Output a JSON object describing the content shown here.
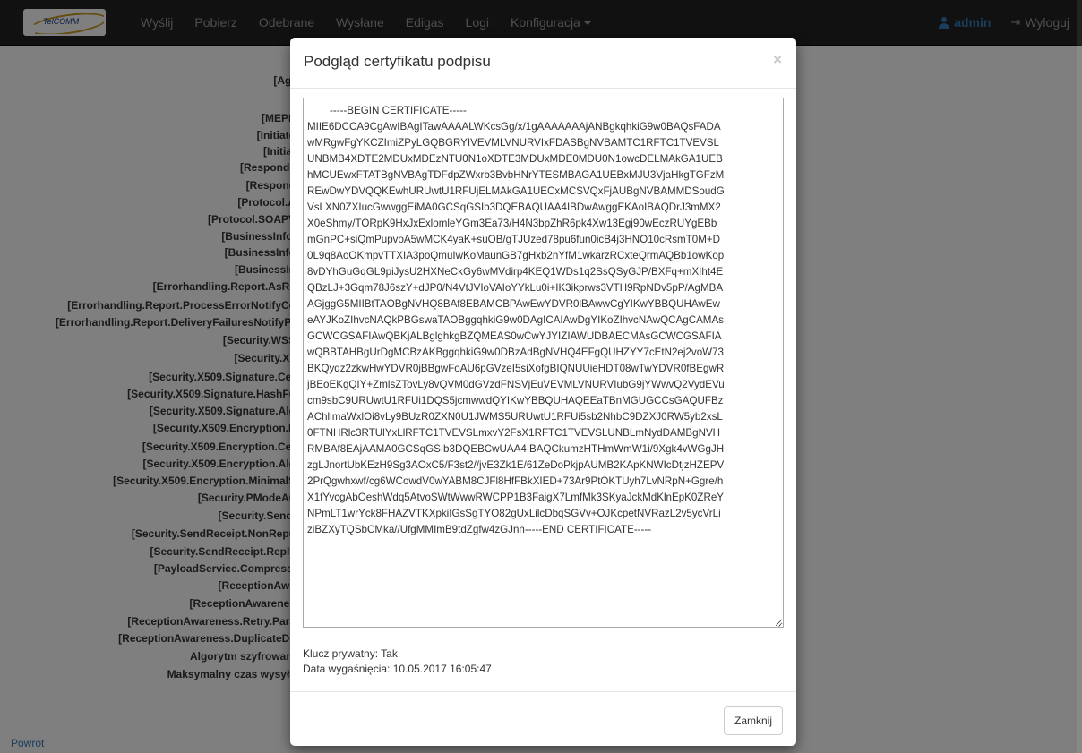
{
  "navbar": {
    "logo_text": "TelCOMM",
    "links": [
      "Wyślij",
      "Pobierz",
      "Odebrane",
      "Wysłane",
      "Edigas",
      "Logi"
    ],
    "config_label": "Konfiguracja",
    "user_label": "admin",
    "logout_label": "Wyloguj"
  },
  "background": {
    "labels": [
      "[Agr",
      "[MEPE",
      "[Initiato",
      "[Initiat",
      "[Responde",
      "[Respond",
      "[Protocol.A",
      "[Protocol.SOAPV",
      "[BusinessInfo.",
      "[BusinessInfo",
      "[BusinessIn",
      "[Errorhandling.Report.AsRe",
      "[Errorhandling.Report.ProcessErrorNotifyCo",
      "[Errorhandling.Report.DeliveryFailuresNotifyPr",
      "[Security.WSS",
      "[Security.X5",
      "[Security.X509.Signature.Cer",
      "[Security.X509.Signature.HashFu",
      "[Security.X509.Signature.Alg",
      "[Security.X509.Encryption.E",
      "[Security.X509.Encryption.Cer",
      "[Security.X509.Encryption.Alg",
      "[Security.X509.Encryption.MinimalS",
      "[Security.PModeAu",
      "[Security.Sendi",
      "[Security.SendReceipt.NonRepu",
      "[Security.SendReceipt.Reply",
      "[PayloadService.Compressi",
      "[ReceptionAwa",
      "[ReceptionAwarenes",
      "[ReceptionAwareness.Retry.Para",
      "[ReceptionAwareness.DuplicateDe",
      "Algorytm szyfrowani",
      "Maksymalny czas wysyła"
    ],
    "back_link": "Powrót"
  },
  "modal": {
    "title": "Podgląd certyfikatu podpisu",
    "close_symbol": "×",
    "certificate_lines": [
      "-----BEGIN CERTIFICATE-----",
      "MIIE6DCCA9CgAwIBAgITawAAAALWKcsGg/x/1gAAAAAAAjANBgkqhkiG9w0BAQsFADA",
      "wMRgwFgYKCZImiZPyLGQBGRYIVEVMLVNURVIxFDASBgNVBAMTC1RFTC1TVEVSL",
      "UNBMB4XDTE2MDUxMDEzNTU0N1oXDTE3MDUxMDE0MDU0N1owcDELMAkGA1UEB",
      "hMCUEwxFTATBgNVBAgTDFdpZWxrb3BvbHNrYTESMBAGA1UEBxMJU3VjaHkgTGFzM",
      "REwDwYDVQQKEwhURUwtU1RFUjELMAkGA1UECxMCSVQxFjAUBgNVBAMMDSoudG",
      "VsLXN0ZXIucGwwggEiMA0GCSqGSIb3DQEBAQUAA4IBDwAwggEKAoIBAQDrJ3mMX2",
      "X0eShmy/TORpK9HxJxExlomleYGm3Ea73/H4N3bpZhR6pk4Xw13Egj90wEczRUYgEBb",
      "mGnPC+siQmPupvoA5wMCK4yaK+suOB/gTJUzed78pu6fun0icB4j3HNO10cRsmT0M+D",
      "0L9q8AoOKmpvTTXIA3poQmuIwKoMaunGB7gHxb2nYfM1wkarzRCxteQrmAQBb1owKop",
      "8vDYhGuGqGL9piJysU2HXNeCkGy6wMVdirp4KEQ1WDs1q2SsQSyGJP/BXFq+mXIht4E",
      "QBzLJ+3Gqm78J6szY+dJP0/N4VtJVIoVAIoYYkLu0i+IK3ikprws3VTH9RpNDv5pP/AgMBA",
      "AGjggG5MIIBtTAOBgNVHQ8BAf8EBAMCBPAwEwYDVR0lBAwwCgYIKwYBBQUHAwEw",
      "eAYJKoZIhvcNAQkPBGswaTAOBggqhkiG9w0DAgICAIAwDgYIKoZIhvcNAwQCAgCAMAs",
      "GCWCGSAFIAwQBKjALBglghkgBZQMEAS0wCwYJYIZIAWUDBAECMAsGCWCGSAFIA",
      "wQBBTAHBgUrDgMCBzAKBggqhkiG9w0DBzAdBgNVHQ4EFgQUHZYY7cEtN2ej2voW73",
      "BKQyqz2zkwHwYDVR0jBBgwFoAU6pGVzeI5siXofgBIQNUUieHDT08wTwYDVR0fBEgwR",
      "jBEoEKgQIY+ZmlsZTovLy8vQVM0dGVzdFNSVjEuVEVMLVNURVIubG9jYWwvQ2VydEVu",
      "cm9sbC9URUwtU1RFUi1DQS5jcmwwdQYIKwYBBQUHAQEEaTBnMGUGCCsGAQUFBz",
      "AChllmaWxlOi8vLy9BUzR0ZXN0U1JWMS5URUwtU1RFUi5sb2NhbC9DZXJ0RW5yb2xsL",
      "0FTNHRlc3RTUlYxLlRFTC1TVEVSLmxvY2FsX1RFTC1TVEVSLUNBLmNydDAMBgNVH",
      "RMBAf8EAjAAMA0GCSqGSIb3DQEBCwUAA4IBAQCkumzHTHmWmW1i/9Xgk4vWGgJH",
      "zgLJnortUbKEzH9Sg3AOxC5/F3st2//jvE3Zk1E/61ZeDoPkjpAUMB2KApKNWIcDtjzHZEPV",
      "2PrQgwhxwf/cg6WCowdV0wYABM8CJFl8HfFBkXIED+73Ar9PtOKTUyh7LvNRpN+Ggre/h",
      "X1fYvcgAbOeshWdq5AtvoSWtWwwRWCPP1B3FaigX7LmfMk3SKyaJckMdKlnEpK0ZReY",
      "NPmLT1wrYck8FHAZVTKXpkiIGsSgTYO82gUxLilcDbqSGVv+OJKcpetNVRazL2v5ycVrLi",
      "ziBZXyTQSbCMka//UfgMMImB9tdZgfw4zGJnn-----END CERTIFICATE-----"
    ],
    "private_key": "Klucz prywatny: Tak",
    "expiry": "Data wygaśnięcia: 10.05.2017 16:05:47",
    "close_button": "Zamknij"
  }
}
